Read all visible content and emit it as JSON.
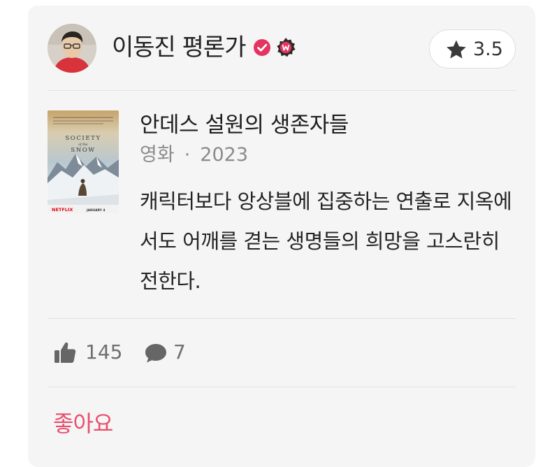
{
  "review": {
    "author": "이동진 평론가",
    "rating": "3.5",
    "movie": {
      "title": "안데스 설원의 생존자들",
      "category": "영화",
      "separator": "·",
      "year": "2023",
      "poster": {
        "title_lines": [
          "SOCIETY",
          "of the",
          "SNOW"
        ],
        "brand": "NETFLIX",
        "release": "JANUARY 4"
      }
    },
    "text": "캐릭터보다 앙상블에 집중하는 연출로 지옥에서도 어깨를 겯는 생명들의 희망을 고스란히 전한다.",
    "likes": "145",
    "comments": "7",
    "like_action": "좋아요"
  },
  "colors": {
    "accent": "#e8506e",
    "badge": "#e4345f",
    "card_bg": "#f5f5f5"
  },
  "icons": [
    "verified-check-icon",
    "watcha-w-badge-icon",
    "star-icon",
    "thumbs-up-icon",
    "comment-icon"
  ]
}
